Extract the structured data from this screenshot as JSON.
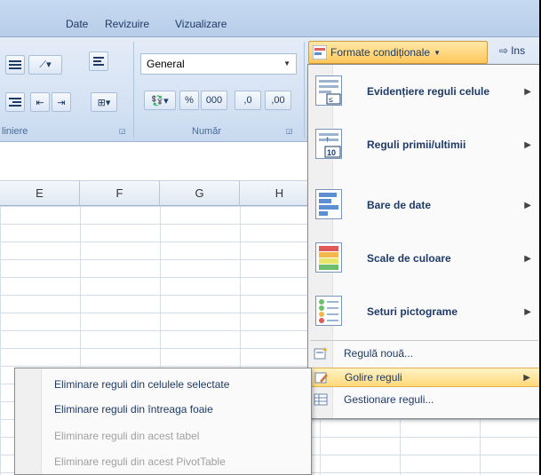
{
  "tabs": [
    "Date",
    "Revizuire",
    "Vizualizare"
  ],
  "ribbon": {
    "group_alignment": "liniere",
    "group_number": "Număr",
    "number_format": "General",
    "percent": "%",
    "thousands": "000",
    "inc_dec": ",0",
    "conditional_formatting": "Formate condiționale",
    "insert": "Ins"
  },
  "columns": [
    "E",
    "F",
    "G",
    "H"
  ],
  "menu": {
    "items_big": [
      {
        "label": "Evidențiere reguli celule"
      },
      {
        "label": "Reguli primii/ultimii"
      },
      {
        "label": "Bare de date"
      },
      {
        "label": "Scale de culoare"
      },
      {
        "label": "Seturi pictograme"
      }
    ],
    "new_rule": "Regulă nouă...",
    "clear_rules": "Golire reguli",
    "manage_rules": "Gestionare reguli..."
  },
  "submenu": {
    "items": [
      {
        "label": "Eliminare reguli din celulele selectate",
        "enabled": true
      },
      {
        "label": "Eliminare reguli din întreaga foaie",
        "enabled": true
      },
      {
        "label": "Eliminare reguli din acest tabel",
        "enabled": false
      },
      {
        "label": "Eliminare reguli din acest PivotTable",
        "enabled": false
      }
    ]
  }
}
